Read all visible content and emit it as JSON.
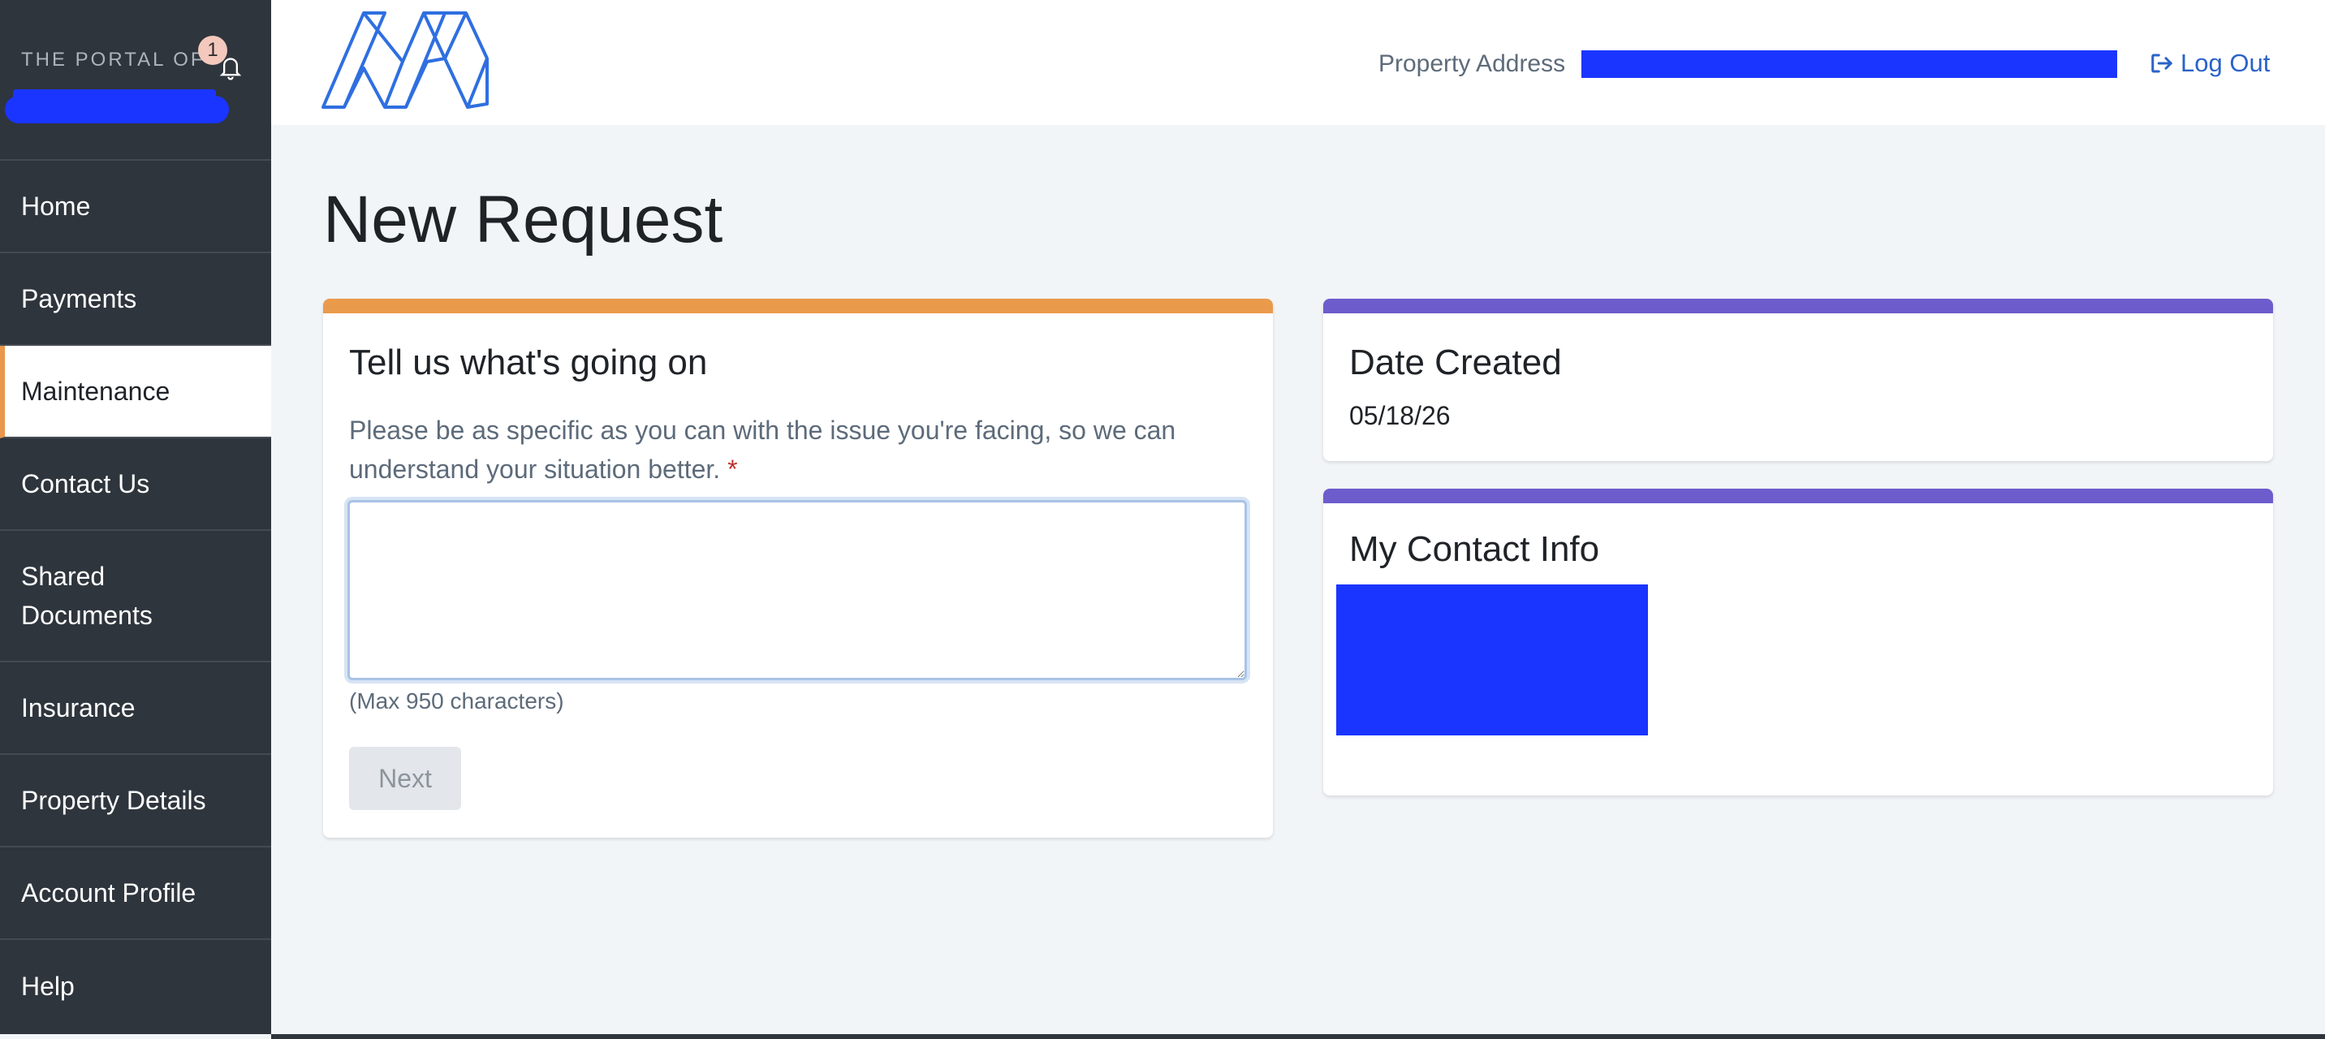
{
  "sidebar": {
    "portal_label": "THE PORTAL OF",
    "notification_count": "1",
    "items": [
      {
        "label": "Home"
      },
      {
        "label": "Payments"
      },
      {
        "label": "Maintenance"
      },
      {
        "label": "Contact Us"
      },
      {
        "label": "Shared Documents"
      },
      {
        "label": "Insurance"
      },
      {
        "label": "Property Details"
      },
      {
        "label": "Account Profile"
      },
      {
        "label": "Help"
      }
    ],
    "active_item": "Maintenance"
  },
  "header": {
    "property_address_label": "Property Address",
    "logout_label": "Log Out"
  },
  "main": {
    "page_title": "New Request",
    "issue_card": {
      "title": "Tell us what's going on",
      "description": "Please be as specific as you can with the issue you're facing, so we can understand your situation better.",
      "required_mark": "*",
      "textarea_value": "",
      "max_chars_note": "(Max 950 characters)",
      "next_label": "Next"
    },
    "date_card": {
      "title": "Date Created",
      "value": "05/18/26"
    },
    "contact_card": {
      "title": "My Contact Info"
    }
  },
  "colors": {
    "sidebar_bg": "#2f353d",
    "issue_accent": "#ea9a4b",
    "info_accent": "#6d5ccc",
    "link": "#2a63c9",
    "redaction": "#1a35ff"
  }
}
